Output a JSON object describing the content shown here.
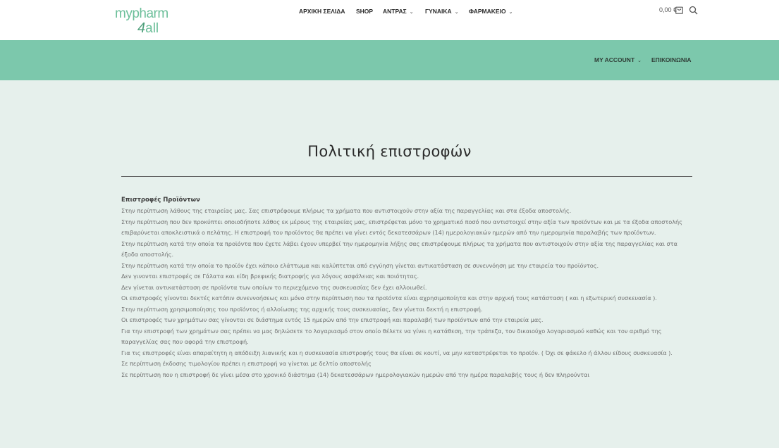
{
  "header": {
    "logo_top": "mypharm",
    "logo_four": "4",
    "logo_bottom": "all",
    "nav": [
      {
        "label": "ΑΡΧΙΚΗ ΣΕΛΙΔΑ",
        "has_dropdown": false
      },
      {
        "label": "SHOP",
        "has_dropdown": false
      },
      {
        "label": "ΑΝΤΡΑΣ",
        "has_dropdown": true
      },
      {
        "label": "ΓΥΝΑΙΚΑ",
        "has_dropdown": true
      },
      {
        "label": "ΦΑΡΜΑΚΕΙΟ",
        "has_dropdown": true
      }
    ],
    "cart_total": "0,00 €",
    "cart_icon": "cart-icon",
    "search_icon": "search-icon"
  },
  "secondary_nav": [
    {
      "label": "MY ACCOUNT",
      "has_dropdown": true
    },
    {
      "label": "ΕΠΙΚΟΙΝΩΝΙΑ",
      "has_dropdown": false
    }
  ],
  "page": {
    "title": "Πολιτική επιστροφών",
    "section_heading": "Επιστροφές Προϊόντων",
    "paragraphs": [
      "Στην περίπτωση λάθους της εταιρείας μας. Σας επιστρέφουμε πλήρως τα χρήματα που αντιστοιχούν στην αξία της παραγγελίας και στα έξοδα αποστολής.",
      "Στην περίπτωση που δεν προκύπτει οποιοδήποτε λάθος εκ μέρους της εταιρείας μας, επιστρέφεται μόνο το χρηματικό ποσό που αντιστοιχεί στην αξία των προϊόντων και με τα έξοδα αποστολής επιβαρύνεται αποκλειστικά ο πελάτης. Η επιστροφή του προϊόντος θα πρέπει να γίνει εντός δεκατεσσάρων (14) ημερολογιακών ημερών από την ημερομηνία παραλαβής των προϊόντων.",
      "Στην περίπτωση κατά την οποία τα προϊόντα που έχετε λάβει έχουν υπερβεί την ημερομηνία λήξης σας επιστρέφουμε πλήρως τα χρήματα που αντιστοιχούν στην αξία της παραγγελίας και στα έξοδα αποστολής.",
      "Στην περίπτωση κατά την οποία το προϊόν έχει κάποιο ελάττωμα και καλύπτεται από εγγύηση γίνεται αντικατάσταση σε συνεννόηση με την εταιρεία του προϊόντος.",
      "Δεν γινονται επιστροφές σε Γάλατα και είδη βρεφικής διατροφής για λόγους ασφάλειας και ποιότητας.",
      "Δεν γίνεται αντικατάσταση σε προϊόντα των οποίων το περιεχόμενο της συσκευασίας δεν έχει αλλοιωθεί.",
      "Οι επιστροφές γίνονται δεκτές κατόπιν συνεννοήσεως και μόνο στην περίπτωση που τα προϊόντα είναι αχρησιμοποίητα και στην αρχική τους κατάσταση ( και η εξωτερική συσκευασία ).",
      "Στην περίπτωση χρησιμοποίησης του προϊόντος ή αλλοίωσης της αρχικής τους συσκευασίας, δεν γίνεται δεκτή η επιστροφή.",
      "Οι επιστροφές των χρημάτων σας γίνονται σε διάστημα εντός 15 ημερών από την επιστροφή και παραλαβή των προϊόντων από την εταιρεία μας.",
      "Για την επιστροφή των χρημάτων σας πρέπει να μας δηλώσετε το λογαριασμό στον οποίο θέλετε να γίνει η κατάθεση, την τράπεζα, τον δικαιούχο λογαριασμού καθώς και τον αριθμό της παραγγελίας σας που αφορά την επιστροφή.",
      "Για τις επιστροφές είναι απαραίτητη η απόδειξη λιανικής και η συσκευασία επιστροφής τους θα είναι σε κουτί, να μην καταστρέφεται το προϊόν. ( Όχι σε φάκελο ή άλλου είδους συσκευασία ).",
      "Σε περίπτωση έκδοσης τιμολογίου πρέπει η επιστροφή να γίνεται με δελτίο αποστολής",
      "Σε περίπτωση που η επιστροφή δε γίνει μέσα στο χρονικό διάστημα (14) δεκατεσσάρων ημερολογιακών ημερών από την ημέρα παραλαβής τους ή δεν πληρούνται"
    ]
  },
  "colors": {
    "band": "#7cc8ac",
    "background": "#e6f0ec",
    "logo": "#6cbf9a"
  }
}
